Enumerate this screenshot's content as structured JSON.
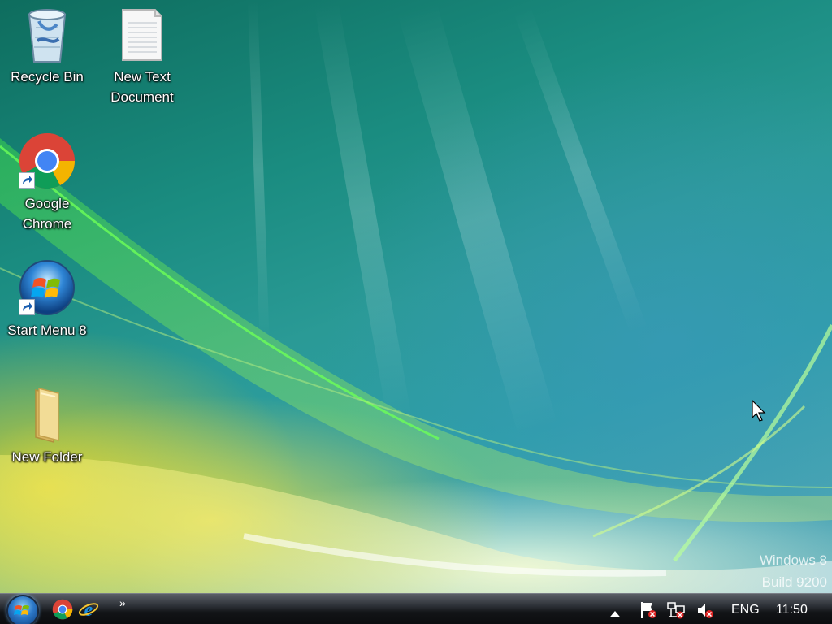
{
  "desktop": {
    "icons": [
      {
        "label": "Recycle Bin"
      },
      {
        "label": "New Text\nDocument"
      },
      {
        "label": "Google\nChrome"
      },
      {
        "label": "Start Menu 8"
      },
      {
        "label": "New Folder"
      }
    ],
    "watermark": {
      "line1": "Windows 8",
      "line2": "Build 9200"
    }
  },
  "taskbar": {
    "overflow_chevron": "»",
    "language": "ENG",
    "clock": "11:50"
  },
  "colors": {
    "taskbar": "#121417",
    "chrome_red": "#db4437",
    "chrome_green": "#0f9d58",
    "chrome_yellow": "#f4b400",
    "chrome_blue": "#4285f4",
    "folder": "#e8d28a",
    "ie_blue": "#1a8ee0"
  }
}
